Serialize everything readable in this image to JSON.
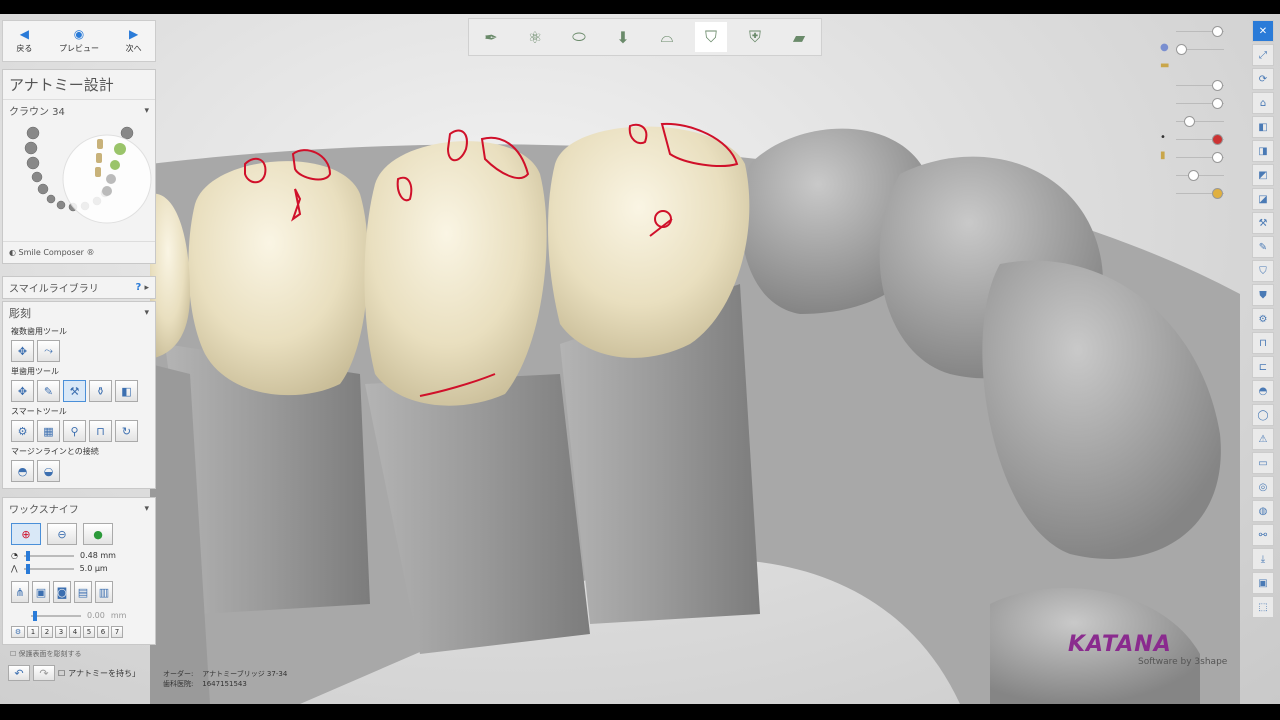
{
  "nav": {
    "back": "戻る",
    "preview": "プレビュー",
    "next": "次へ"
  },
  "panel_title": "アナトミー設計",
  "crown_label": "クラウン 34",
  "smile_composer": "Smile Composer ®",
  "smile_library": "スマイルライブラリ",
  "smile_library_q": "?",
  "sculpt": {
    "title": "彫刻",
    "multi_label": "複数歯用ツール",
    "single_label": "単歯用ツール",
    "smart_label": "スマートツール",
    "margin_label": "マージンラインとの接続"
  },
  "wax": {
    "title": "ワックスナイフ",
    "size_value": "0.48 mm",
    "depth_value": "5.0 μm",
    "offset_value": "0.00",
    "offset_unit": "mm",
    "numbers": [
      "1",
      "2",
      "3",
      "4",
      "5",
      "6",
      "7"
    ]
  },
  "protect_surface": "保護表面を彫刻する",
  "keep_anatomy": "アナトミーを持ち」",
  "order": {
    "label1": "オーダー:",
    "value1": "アナトミーブリッジ 37-34",
    "label2": "歯科医院:",
    "value2": "1647151543"
  },
  "logo": {
    "brand": "KATANA",
    "tagline": "Software by 3shape"
  },
  "colors": {
    "accent": "#2a7bd8",
    "margin_red": "#d0102a",
    "crown": "#efe6c6"
  },
  "icons": {
    "back": "arrow-left-icon",
    "preview": "eye-icon",
    "next": "arrow-right-icon"
  }
}
